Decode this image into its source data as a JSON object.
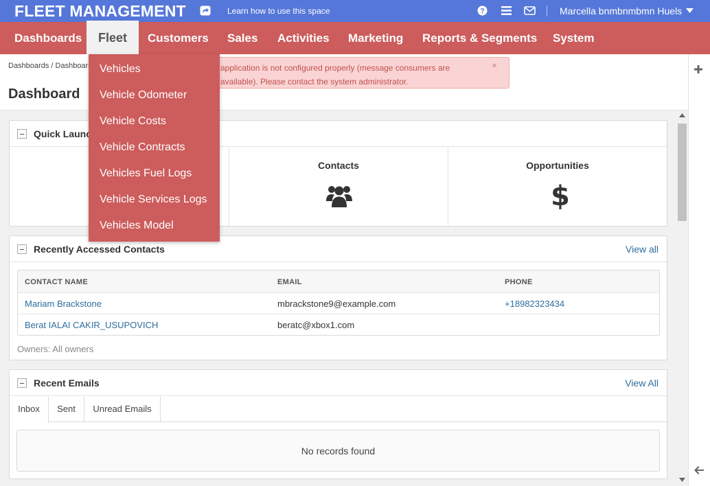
{
  "header": {
    "brand": "FLEET MANAGEMENT",
    "learn_link": "Learn how to use this space",
    "user_name": "Marcella bnmbnmbmn Huels"
  },
  "nav": {
    "items": [
      "Dashboards",
      "Fleet",
      "Customers",
      "Sales",
      "Activities",
      "Marketing",
      "Reports & Segments",
      "System"
    ],
    "active": "Fleet"
  },
  "fleet_menu": {
    "items": [
      "Vehicles",
      "Vehicle Odometer",
      "Vehicle Costs",
      "Vehicle Contracts",
      "Vehicles Fuel Logs",
      "Vehicle Services Logs",
      "Vehicles Model"
    ]
  },
  "breadcrumb": {
    "first": "Dashboards",
    "separator": "/",
    "second": "Dashboard"
  },
  "page_title": "Dashboard",
  "alert": {
    "message_line1": "application is not configured properly (message consumers are",
    "message_line2": "available). Please contact the system administrator.",
    "close": "×"
  },
  "quick_launch": {
    "title": "Quick Launchpad",
    "items": [
      {
        "label": "Contacts",
        "icon": "users-icon"
      },
      {
        "label": "Opportunities",
        "icon": "dollar-icon",
        "glyph": "$"
      }
    ]
  },
  "recent_contacts": {
    "title": "Recently Accessed Contacts",
    "view_all": "View all",
    "columns": [
      "CONTACT NAME",
      "EMAIL",
      "PHONE"
    ],
    "rows": [
      {
        "name": "Mariam Brackstone",
        "email": "mbrackstone9@example.com",
        "phone": "+18982323434"
      },
      {
        "name": "Berat IALAI CAKIR_USUPOVICH",
        "email": "beratc@xbox1.com",
        "phone": ""
      }
    ],
    "owners": "Owners: All owners"
  },
  "recent_emails": {
    "title": "Recent Emails",
    "view_all": "View All",
    "tabs": [
      "Inbox",
      "Sent",
      "Unread Emails"
    ],
    "active_tab": "Inbox",
    "empty_message": "No records found"
  },
  "colors": {
    "topbar": "#5577d9",
    "nav": "#cd5c5c",
    "link": "#2e6e9e",
    "alert_bg": "#fad4d4",
    "alert_text": "#c0504d"
  }
}
